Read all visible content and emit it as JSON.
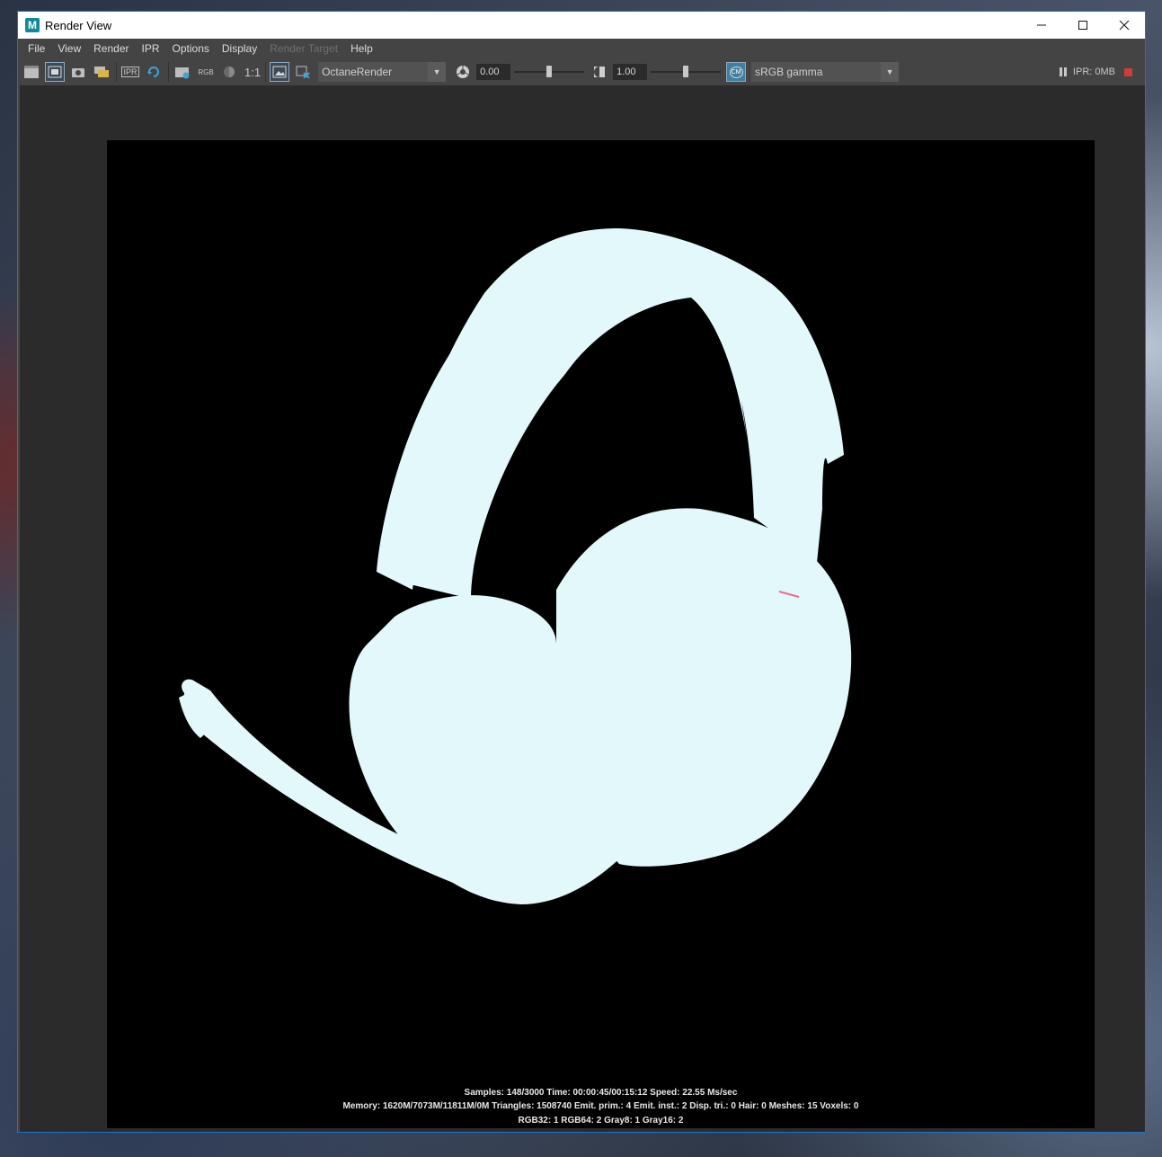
{
  "window": {
    "title": "Render View",
    "app_icon_letter": "M"
  },
  "menu": {
    "items": [
      "File",
      "View",
      "Render",
      "IPR",
      "Options",
      "Display",
      "Render Target",
      "Help"
    ]
  },
  "toolbar": {
    "rgb_label": "RGB",
    "ipr_label": "IPR",
    "ratio_label": "1:1",
    "renderer": "OctaneRender",
    "exposure_value": "0.00",
    "exposure_level": 0.5,
    "gamma_value": "1.00",
    "gamma_level": 0.5,
    "color_mgmt_badge": "CM",
    "color_space": "sRGB gamma",
    "ipr_memory": "IPR: 0MB"
  },
  "render": {
    "stats_line1": "Samples: 148/3000 Time: 00:00:45/00:15:12 Speed: 22.55 Ms/sec",
    "stats_line2": "Memory: 1620M/7073M/11811M/0M Triangles: 1508740 Emit. prim.: 4 Emit. inst.: 2 Disp. tri.: 0 Hair: 0 Meshes: 15 Voxels: 0",
    "stats_line3": "RGB32: 1 RGB64: 2 Gray8: 1 Gray16: 2"
  },
  "colors": {
    "accent": "#1e72c8",
    "headset_fill": "#e2f8fa",
    "stop": "#d23b3b"
  }
}
